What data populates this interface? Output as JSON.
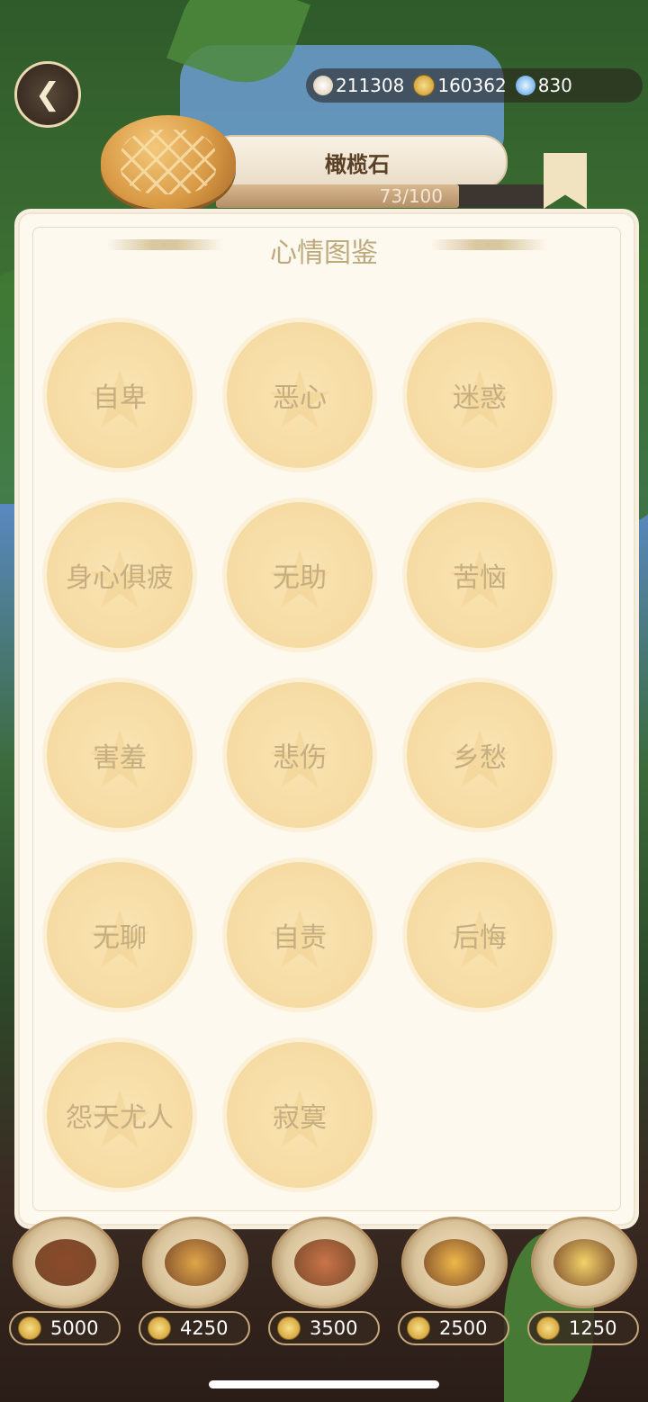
{
  "currencies": [
    {
      "icon": "shell-icon",
      "value": "211308"
    },
    {
      "icon": "coin-icon",
      "value": "160362"
    },
    {
      "icon": "gem-icon",
      "value": "830"
    }
  ],
  "food": {
    "name": "橄榄石",
    "progress_text": "73/100",
    "progress_fraction": 0.73
  },
  "panel": {
    "title": "心情图鉴",
    "moods": [
      "自卑",
      "恶心",
      "迷惑",
      "身心俱疲",
      "无助",
      "苦恼",
      "害羞",
      "悲伤",
      "乡愁",
      "无聊",
      "自责",
      "后悔",
      "怨天尤人",
      "寂寞"
    ]
  },
  "foods": [
    {
      "icon": "burger-icon",
      "price": "5000"
    },
    {
      "icon": "pancake-icon",
      "price": "4250"
    },
    {
      "icon": "sandwich-icon",
      "price": "3500"
    },
    {
      "icon": "strawberry-cake-icon",
      "price": "2500"
    },
    {
      "icon": "egg-tart-icon",
      "price": "1250"
    }
  ],
  "colors": {
    "panel_bg": "#fdf9ef",
    "badge": "#f6dba3",
    "badge_text": "#c6ae80",
    "title": "#bda97c"
  }
}
